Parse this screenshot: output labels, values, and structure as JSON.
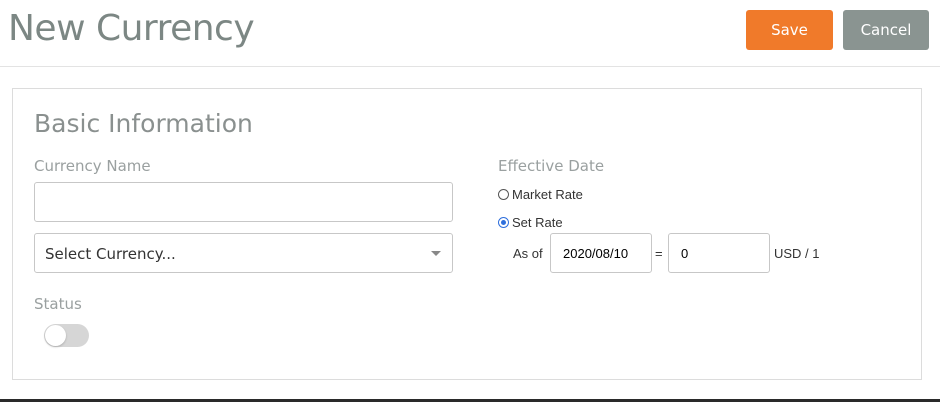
{
  "header": {
    "title": "New Currency",
    "save_label": "Save",
    "cancel_label": "Cancel"
  },
  "basic_info": {
    "section_title": "Basic Information",
    "currency_name_label": "Currency Name",
    "currency_name_value": "",
    "select_currency_value": "Select Currency...",
    "status_label": "Status",
    "status_enabled": false
  },
  "effective_date": {
    "label": "Effective Date",
    "options": [
      {
        "label": "Market Rate",
        "checked": false
      },
      {
        "label": "Set Rate",
        "checked": true
      }
    ],
    "as_of_label": "As of",
    "date_value": "2020/08/10",
    "equals": "=",
    "rate_value": "0",
    "unit_label": "USD / 1"
  },
  "colors": {
    "save": "#f07a2a",
    "cancel": "#8a9491",
    "radio_checked": "#2f6fdc"
  }
}
